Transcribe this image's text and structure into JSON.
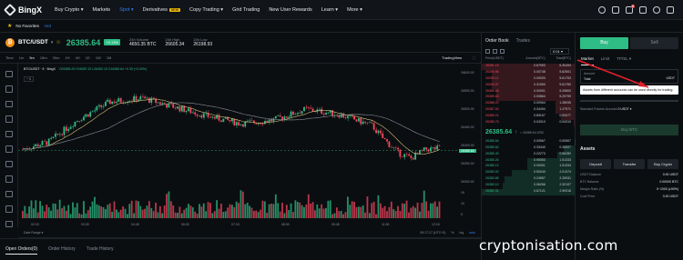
{
  "nav": {
    "logo": "BingX",
    "items": [
      {
        "label": "Buy Crypto ▾",
        "active": false
      },
      {
        "label": "Markets",
        "active": false
      },
      {
        "label": "Spot ▾",
        "active": true
      },
      {
        "label": "Derivatives",
        "active": false,
        "badge": "NEW"
      },
      {
        "label": "Copy Trading ▾",
        "active": false
      },
      {
        "label": "Grid Trading",
        "active": false
      },
      {
        "label": "New User Rewards",
        "active": false
      },
      {
        "label": "Learn ▾",
        "active": false
      },
      {
        "label": "More ▾",
        "active": false
      }
    ],
    "notif_count": "8"
  },
  "favorites": {
    "label": "No Favorites",
    "add": "Hot"
  },
  "symbol": {
    "pair": "BTC/USDT",
    "price": "26385.64",
    "change": "+0.13%",
    "stats": [
      {
        "label": "24h Volume",
        "value": "4650.35 BTC"
      },
      {
        "label": "24h High",
        "value": "26605.34"
      },
      {
        "label": "24h Low",
        "value": "26198.93"
      }
    ]
  },
  "chart_toolbar": {
    "intervals": [
      "Time",
      "1m",
      "5m",
      "15m",
      "30m",
      "1H",
      "4H",
      "1D",
      "1W",
      "1M"
    ],
    "view": "TradingView"
  },
  "chart_legend": {
    "pair": "BTC/USDT · 5 · BingX",
    "ohlc": "O26385.29 H26387.22 L26382.15 C26385.64 +0.35 (+0.00%)",
    "ma_toggle": "~ 1"
  },
  "chart_data": {
    "type": "candlestick",
    "ylim": [
      26300,
      26600
    ],
    "y_ticks": [
      "26600.00",
      "26550.00",
      "26500.00",
      "26450.00",
      "26400.00",
      "26350.00",
      "26300.00"
    ],
    "x_ticks": [
      "02:15",
      "03:30",
      "04:45",
      "06:00",
      "07:15",
      "08:30",
      "09:45",
      "11:00",
      "12:15"
    ],
    "current_price": "26385.64",
    "vol_ticks": [
      "15",
      "10",
      "5"
    ]
  },
  "chart_bottom": {
    "left": "Date Range ▾",
    "time": "09:17:17 (UTC+3)",
    "pct": "%",
    "log": "log",
    "auto": "auto"
  },
  "order_tabs": [
    "Open Orders(0)",
    "Order History",
    "Trade History"
  ],
  "book": {
    "tabs": [
      "Order Book",
      "Trades"
    ],
    "step": "0.01 ▾",
    "headers": [
      "Price(USDT)",
      "Amount(BTC)",
      "Total(BTC)"
    ],
    "asks": [
      [
        "26391.15",
        "0.67993",
        "6.30494"
      ],
      [
        "26390.96",
        "0.00748",
        "5.62501"
      ],
      [
        "26390.11",
        "0.00003",
        "5.61753"
      ],
      [
        "26390.07",
        "0.31950",
        "5.61750"
      ],
      [
        "26389.68",
        "0.00001",
        "5.29800"
      ],
      [
        "26389.63",
        "0.00864",
        "5.29799"
      ],
      [
        "26388.20",
        "0.00964",
        "1.28935"
      ],
      [
        "26387.92",
        "0.34494",
        "1.27971"
      ],
      [
        "26386.21",
        "0.89167",
        "0.93477"
      ],
      [
        "26385.75",
        "0.04310",
        "0.04310"
      ]
    ],
    "mid_price": "26385.64",
    "mid_arrow": "↑",
    "mid_sub": "≈ 26385.64 USD",
    "bids": [
      [
        "26385.64",
        "0.00567",
        "0.00567"
      ],
      [
        "26385.62",
        "0.33440",
        "0.34007"
      ],
      [
        "26385.40",
        "0.22273",
        "0.56280"
      ],
      [
        "26385.26",
        "0.95053",
        "1.51333"
      ],
      [
        "26385.12",
        "0.00001",
        "1.51334"
      ],
      [
        "26383.92",
        "0.50040",
        "2.01374"
      ],
      [
        "26383.65",
        "0.24557",
        "2.25931"
      ],
      [
        "26383.10",
        "0.06266",
        "2.32197"
      ],
      [
        "26382.31",
        "0.67121",
        "2.99318"
      ]
    ]
  },
  "trade": {
    "buy": "Buy",
    "sell": "Sell",
    "order_types": [
      "Market",
      "Limit",
      "TP/SL ▾"
    ],
    "amount_label": "Amount",
    "amount_value": "Total",
    "amount_unit": "USDT",
    "tooltip": "Assets from different accounts can be used directly for trading.",
    "available_label": "Standard Futures Account",
    "available_value": "0 USDT ▾",
    "buy_button": "Buy BTC",
    "assets_title": "Assets",
    "asset_buttons": [
      "Deposit",
      "Transfer",
      "Buy Crypto"
    ],
    "asset_rows": [
      {
        "label": "USDT Balance",
        "value": "0.00 USDT"
      },
      {
        "label": "BTC Balance",
        "value": "0.00000 BTC"
      },
      {
        "label": "Margin Ratio (%)",
        "value": "0~1000 (≥90%)"
      },
      {
        "label": "Cost Price",
        "value": "0.00 USDT"
      }
    ]
  },
  "watermark": "cryptonisation.com",
  "colors": {
    "up": "#2ebd85",
    "down": "#f6465d",
    "accent": "#2f7ef0",
    "annotation": "#e0202a"
  }
}
